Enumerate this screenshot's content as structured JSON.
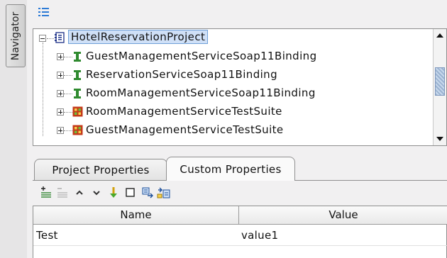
{
  "navigator": {
    "tab_label": "Navigator"
  },
  "toolbar": {
    "icon": "tree-layout-icon"
  },
  "tree": {
    "root": {
      "label": "HotelReservationProject",
      "icon": "project-icon",
      "expanded": true
    },
    "items": [
      {
        "label": "GuestManagementServiceSoap11Binding",
        "icon": "interface-icon"
      },
      {
        "label": "ReservationServiceSoap11Binding",
        "icon": "interface-icon"
      },
      {
        "label": "RoomManagementServiceSoap11Binding",
        "icon": "interface-icon"
      },
      {
        "label": "RoomManagementServiceTestSuite",
        "icon": "testsuite-icon"
      },
      {
        "label": "GuestManagementServiceTestSuite",
        "icon": "testsuite-icon"
      }
    ]
  },
  "tabs": [
    {
      "label": "Project Properties",
      "active": false
    },
    {
      "label": "Custom Properties",
      "active": true
    }
  ],
  "properties_toolbar": {
    "icons": [
      "add-property-icon",
      "remove-property-icon",
      "move-up-icon",
      "move-down-icon",
      "load-icon",
      "clear-icon",
      "save-icon",
      "load-from-file-icon"
    ]
  },
  "table": {
    "columns": [
      "Name",
      "Value"
    ],
    "rows": [
      {
        "name": "Test",
        "value": "value1"
      }
    ]
  },
  "colors": {
    "selection_bg": "#cfe0f7",
    "interface_green": "#2f8a2f",
    "testsuite_red": "#c43a1a"
  }
}
